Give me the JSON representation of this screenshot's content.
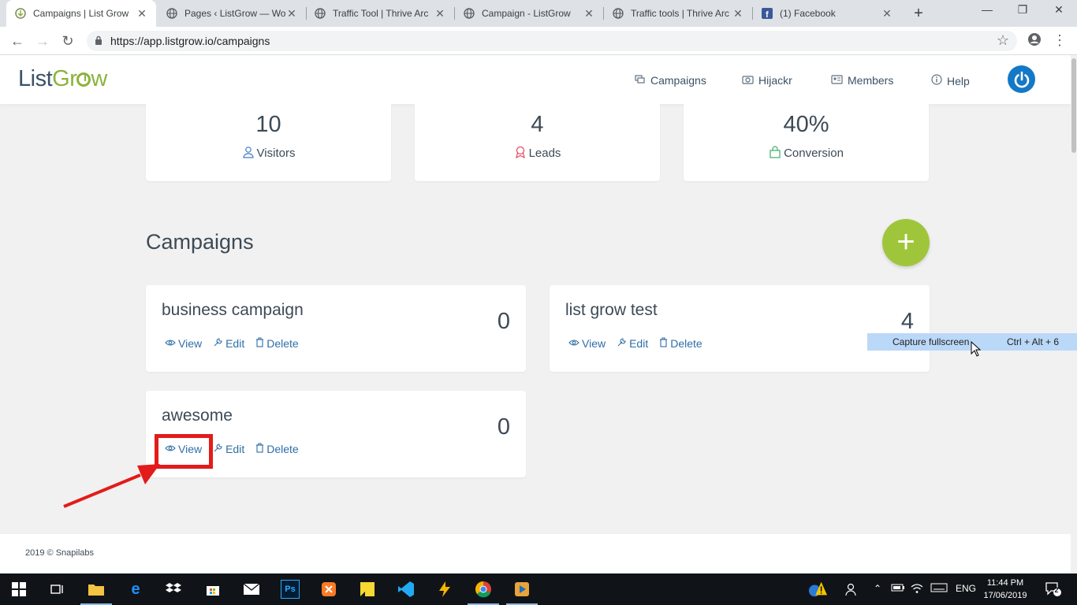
{
  "browser": {
    "tabs": [
      {
        "title": "Campaigns | List Grow",
        "icon": "listgrow-favicon-icon",
        "active": true
      },
      {
        "title": "Pages ‹ ListGrow — Wo",
        "icon": "globe-icon",
        "active": false
      },
      {
        "title": "Traffic Tool | Thrive Arc",
        "icon": "globe-icon",
        "active": false
      },
      {
        "title": "Campaign - ListGrow",
        "icon": "globe-icon",
        "active": false
      },
      {
        "title": "Traffic tools | Thrive Arc",
        "icon": "globe-icon",
        "active": false
      },
      {
        "title": "(1) Facebook",
        "icon": "facebook-icon",
        "active": false
      }
    ],
    "url": "https://app.listgrow.io/campaigns"
  },
  "header": {
    "logo_part1": "List",
    "logo_part2": "Gr",
    "logo_part3": "w",
    "nav": [
      {
        "label": "Campaigns",
        "icon": "campaigns-icon"
      },
      {
        "label": "Hijackr",
        "icon": "camera-icon"
      },
      {
        "label": "Members",
        "icon": "id-card-icon"
      },
      {
        "label": "Help",
        "icon": "info-icon"
      }
    ]
  },
  "stats": [
    {
      "value": "10",
      "label": "Visitors",
      "icon": "user-icon",
      "color": "#3f7cc4"
    },
    {
      "value": "4",
      "label": "Leads",
      "icon": "award-icon",
      "color": "#e0485f"
    },
    {
      "value": "40%",
      "label": "Conversion",
      "icon": "shopping-bag-icon",
      "color": "#3eac6b"
    }
  ],
  "campaigns": {
    "title": "Campaigns",
    "add_label": "+",
    "action_labels": {
      "view": "View",
      "edit": "Edit",
      "delete": "Delete"
    },
    "items": [
      {
        "name": "business campaign",
        "count": "0"
      },
      {
        "name": "list grow test",
        "count": "4"
      },
      {
        "name": "awesome",
        "count": "0"
      }
    ]
  },
  "tooltip": {
    "label": "Capture fullscreen",
    "shortcut": "Ctrl + Alt + 6"
  },
  "footer": {
    "text": "2019 © Snapilabs"
  },
  "taskbar": {
    "language": "ENG",
    "time": "11:44 PM",
    "date": "17/06/2019",
    "notifications": "2"
  },
  "colors": {
    "accent_green": "#9fc63b",
    "link_blue": "#2f6ea7",
    "power_blue": "#1379c6",
    "highlight_red": "#e31b1b"
  }
}
